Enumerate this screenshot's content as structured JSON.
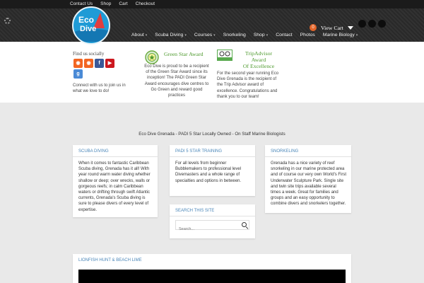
{
  "topbar": {
    "links": [
      "Contact Us",
      "Shop",
      "Cart",
      "Checkout"
    ]
  },
  "logo": {
    "line1": "Eco",
    "line2": "Dive"
  },
  "nav": {
    "items": [
      {
        "label": "About",
        "has_submenu": true
      },
      {
        "label": "Scuba Diving",
        "has_submenu": true
      },
      {
        "label": "Courses",
        "has_submenu": true
      },
      {
        "label": "Snorkeling",
        "has_submenu": false
      },
      {
        "label": "Shop",
        "has_submenu": true
      },
      {
        "label": "Contact",
        "has_submenu": false
      },
      {
        "label": "Photos",
        "has_submenu": false
      },
      {
        "label": "Marine Biology",
        "has_submenu": true
      }
    ],
    "caret": "▾"
  },
  "cart": {
    "count": "0",
    "label": "View Cart"
  },
  "social_sidebar": {
    "title": "Find us socially",
    "icons": [
      {
        "name": "rss-icon",
        "glyph": "◉",
        "color": "#f26522"
      },
      {
        "name": "rss-icon",
        "glyph": "◉",
        "color": "#f26522"
      },
      {
        "name": "facebook-icon",
        "glyph": "f",
        "color": "#3b5998"
      },
      {
        "name": "youtube-icon",
        "glyph": "▶",
        "color": "#cc181e"
      },
      {
        "name": "google-icon",
        "glyph": "g",
        "color": "#4a8ad6"
      }
    ],
    "connect_text": "Connect with us to join us in what we love to do!"
  },
  "awards": {
    "green_star": {
      "title": "Green Star Award",
      "body": "Eco Dive is proud to be a recipient of the Green Star Award since its inception! The PADI Green Star Award encourages dive centres to Go Green and reward good practices"
    },
    "tripadvisor": {
      "title_line1": "TripAdvisor Award",
      "title_line2": "Of Excellence",
      "body": "For the second year running Eco Dive Grenada is the recipient of the Trip Advisor award of excellence. Congratulations and thank you to our team!"
    }
  },
  "tagline": "Eco Dive Grenada - PADI 5 Star Locally Owned - On Staff Marine Biologists",
  "cards": {
    "scuba": {
      "heading": "SCUBA DIVING",
      "text": "When it comes to fantastic Caribbean Scuba diving, Grenada has it all! With year round warm water diving whether shallow or deep; over wrecks, walls or gorgeous reefs; in calm Caribbean waters or drifting through swift Atlantic currents, Grenada's Scuba diving is sure to please divers of every level of expertise."
    },
    "padi": {
      "heading": "PADI 5 STAR TRAINING",
      "text": "For all levels from beginner Bubblemakers to professional level Divemasters and a whole range of specialties and options in between."
    },
    "snorkeling": {
      "heading": "SNORKELING",
      "text": "Grenada has a nice variety of reef snorkeling in our marine protected area and of course our very own World's First Underwater Sculpture Park. Single site and twin site trips available several times a week. Great for families and groups and an easy opportunity to combine divers and snorkelers together."
    },
    "search": {
      "heading": "SEARCH THIS SITE",
      "placeholder": "Search..."
    },
    "lionfish": {
      "heading": "LIONFISH HUNT & BEACH LIME"
    }
  }
}
